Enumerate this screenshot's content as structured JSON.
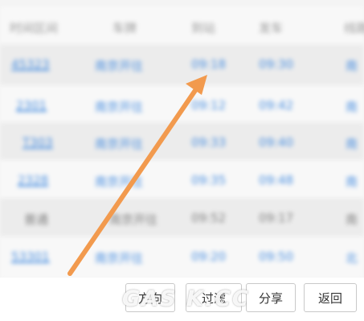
{
  "table": {
    "header": [
      "时间区间",
      "车牌",
      "到站",
      "发车",
      "线路"
    ],
    "rows": [
      [
        "45323",
        "南京开往",
        "09:18",
        "09:30",
        "南"
      ],
      [
        "2301",
        "南京开往",
        "09:12",
        "09:42",
        "南"
      ],
      [
        "T303",
        "南京开往",
        "09:33",
        "09:40",
        "南"
      ],
      [
        "2328",
        "南京开往",
        "09:35",
        "09:48",
        "南"
      ],
      [
        "普通",
        "南京开往",
        "09:52",
        "09:17",
        "南"
      ],
      [
        "53301",
        "南京开往",
        "09:20",
        "09:50",
        "北"
      ]
    ]
  },
  "toolbar": {
    "direction_label": "方向",
    "filter_label": "过滤",
    "share_label": "分享",
    "back_label": "返回"
  },
  "annotation": {
    "arrow_color": "#f29a4e"
  },
  "watermark": {
    "text": "GAS K.CC"
  }
}
